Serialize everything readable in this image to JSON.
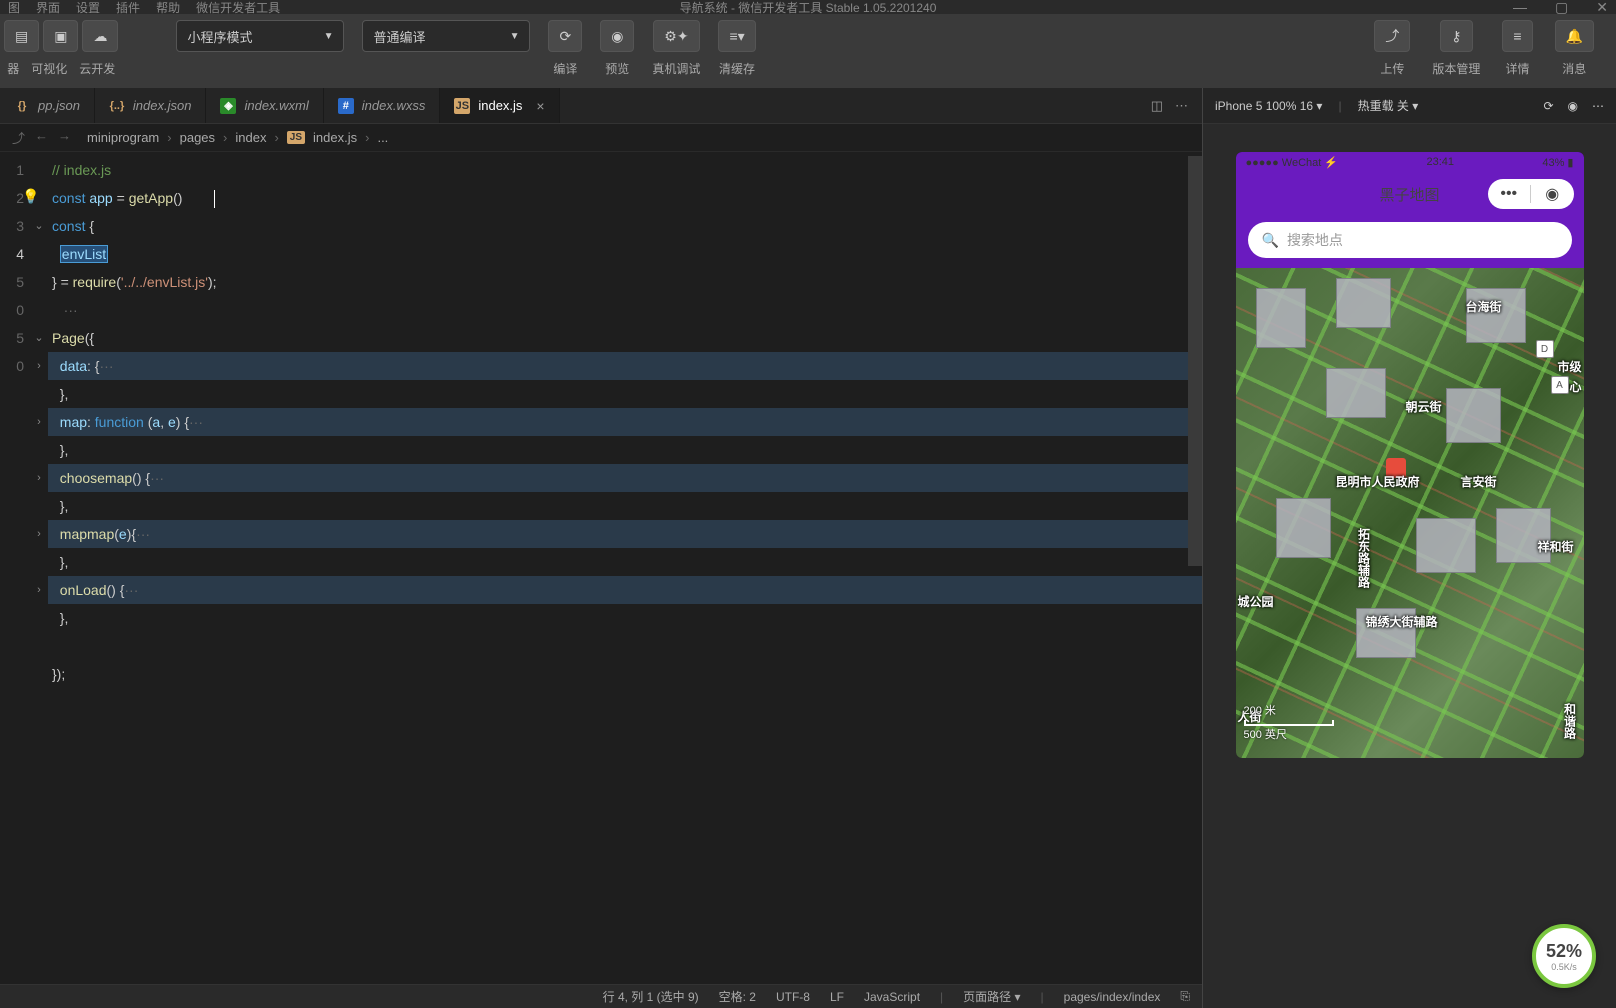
{
  "titlebar": {
    "menus": [
      "图",
      "界面",
      "设置",
      "插件",
      "帮助",
      "微信开发者工具"
    ],
    "title": "导航系统 - 微信开发者工具 Stable 1.05.2201240"
  },
  "toolbar": {
    "left_labels": [
      "器",
      "可视化",
      "云开发"
    ],
    "mode_dropdown": "小程序模式",
    "compile_dropdown": "普通编译",
    "compile": "编译",
    "preview": "预览",
    "real": "真机调试",
    "cache": "清缓存",
    "upload": "上传",
    "version": "版本管理",
    "detail": "详情",
    "message": "消息"
  },
  "tabs": [
    {
      "name": "pp.json",
      "icon": "{}",
      "icon_bg": "#3a3a3a",
      "icon_color": "#d4a66a"
    },
    {
      "name": "index.json",
      "icon": "{..}",
      "icon_bg": "transparent",
      "icon_color": "#d4a66a",
      "italic": true
    },
    {
      "name": "index.wxml",
      "icon": "◈",
      "icon_bg": "#2a8a2a",
      "icon_color": "#fff",
      "italic": true
    },
    {
      "name": "index.wxss",
      "icon": "#",
      "icon_bg": "#2a6aca",
      "icon_color": "#fff",
      "italic": true
    },
    {
      "name": "index.js",
      "icon": "JS",
      "icon_bg": "#d4a66a",
      "icon_color": "#333",
      "active": true
    }
  ],
  "breadcrumb": [
    "miniprogram",
    "pages",
    "index",
    "index.js",
    "..."
  ],
  "code_lines": [
    {
      "n": "1"
    },
    {
      "n": "2"
    },
    {
      "n": "3"
    },
    {
      "n": "4"
    },
    {
      "n": "5"
    },
    {
      "n": ""
    },
    {
      "n": ""
    },
    {
      "n": ""
    },
    {
      "n": ""
    },
    {
      "n": ""
    },
    {
      "n": ""
    },
    {
      "n": ""
    },
    {
      "n": ""
    },
    {
      "n": ""
    },
    {
      "n": ""
    },
    {
      "n": ""
    },
    {
      "n": ""
    },
    {
      "n": ""
    },
    {
      "n": ""
    },
    {
      "n": ""
    }
  ],
  "code": {
    "l1": "// index.js",
    "l2_kw": "const",
    "l2_var": "app",
    "l2_eq": " = ",
    "l2_fn": "getApp",
    "l2_end": "()",
    "l3_kw": "const",
    "l3_brace": " {",
    "l4_sel": "envList",
    "l5_a": "} = ",
    "l5_fn": "require",
    "l5_b": "(",
    "l5_str": "'../../envList.js'",
    "l5_c": ");",
    "l7_fn": "Page",
    "l7_b": "({",
    "l8_prop": "data",
    "l8_b": ": {",
    "l8_dots": "···",
    "l9": "},",
    "l10_prop": "map",
    "l10_a": ": ",
    "l10_kw": "function",
    "l10_b": " (",
    "l10_p1": "a",
    "l10_c": ", ",
    "l10_p2": "e",
    "l10_d": ") {",
    "l10_dots": "···",
    "l11": "},",
    "l12_fn": "choosemap",
    "l12_b": "() {",
    "l12_dots": "···",
    "l13": "},",
    "l14_fn": "mapmap",
    "l14_b": "(",
    "l14_p": "e",
    "l14_c": "){",
    "l14_dots": "···",
    "l15": "},",
    "l16_fn": "onLoad",
    "l16_b": "() {",
    "l16_dots": "···",
    "l17": "},",
    "l19": "});"
  },
  "statusbar": {
    "line_col": "行 4, 列 1 (选中 9)",
    "spaces": "空格: 2",
    "enc": "UTF-8",
    "eol": "LF",
    "lang": "JavaScript",
    "route": "页面路径 ▾",
    "path": "pages/index/index"
  },
  "device": {
    "model": "iPhone 5 100% 16 ▾",
    "reload": "热重载 关 ▾",
    "phone_status_left": "●●●●● WeChat ⚡",
    "phone_status_time": "23:41",
    "phone_status_right": "43% ▮",
    "app_title": "黑子地图",
    "search_placeholder": "搜索地点",
    "map_center_label": "昆明市人民政府",
    "map_labels": {
      "a": "言安街",
      "b": "市级",
      "c": "中心",
      "d": "朝云街",
      "e": "台海街",
      "f": "祥和街",
      "g": "拓东路辅路",
      "h": "锦绣大街辅路",
      "i": "城公园",
      "j": "人街",
      "k": "和谐路"
    },
    "scale_top": "200 米",
    "scale_bot": "500 英尺"
  },
  "perf": {
    "pct": "52%",
    "speed": "0.5K/s"
  }
}
